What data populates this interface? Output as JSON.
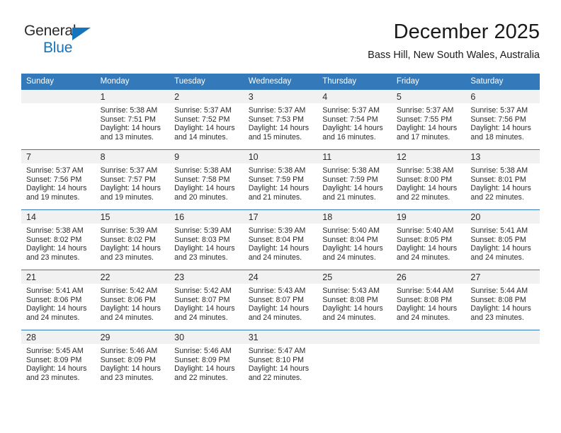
{
  "brand": {
    "name_top": "General",
    "name_bottom": "Blue",
    "triangle_icon": "triangle-icon",
    "colors": {
      "blue": "#1574bb",
      "dark": "#2b2b2b"
    }
  },
  "header": {
    "title": "December 2025",
    "subtitle": "Bass Hill, New South Wales, Australia"
  },
  "calendar": {
    "header_bg": "#3479b9",
    "daynum_bg": "#f1f1f1",
    "weekday_headers": [
      "Sunday",
      "Monday",
      "Tuesday",
      "Wednesday",
      "Thursday",
      "Friday",
      "Saturday"
    ],
    "weeks": [
      [
        {
          "day": "",
          "sunrise": "",
          "sunset": "",
          "daylight_line1": "",
          "daylight_line2": ""
        },
        {
          "day": "1",
          "sunrise": "Sunrise: 5:38 AM",
          "sunset": "Sunset: 7:51 PM",
          "daylight_line1": "Daylight: 14 hours",
          "daylight_line2": "and 13 minutes."
        },
        {
          "day": "2",
          "sunrise": "Sunrise: 5:37 AM",
          "sunset": "Sunset: 7:52 PM",
          "daylight_line1": "Daylight: 14 hours",
          "daylight_line2": "and 14 minutes."
        },
        {
          "day": "3",
          "sunrise": "Sunrise: 5:37 AM",
          "sunset": "Sunset: 7:53 PM",
          "daylight_line1": "Daylight: 14 hours",
          "daylight_line2": "and 15 minutes."
        },
        {
          "day": "4",
          "sunrise": "Sunrise: 5:37 AM",
          "sunset": "Sunset: 7:54 PM",
          "daylight_line1": "Daylight: 14 hours",
          "daylight_line2": "and 16 minutes."
        },
        {
          "day": "5",
          "sunrise": "Sunrise: 5:37 AM",
          "sunset": "Sunset: 7:55 PM",
          "daylight_line1": "Daylight: 14 hours",
          "daylight_line2": "and 17 minutes."
        },
        {
          "day": "6",
          "sunrise": "Sunrise: 5:37 AM",
          "sunset": "Sunset: 7:56 PM",
          "daylight_line1": "Daylight: 14 hours",
          "daylight_line2": "and 18 minutes."
        }
      ],
      [
        {
          "day": "7",
          "sunrise": "Sunrise: 5:37 AM",
          "sunset": "Sunset: 7:56 PM",
          "daylight_line1": "Daylight: 14 hours",
          "daylight_line2": "and 19 minutes."
        },
        {
          "day": "8",
          "sunrise": "Sunrise: 5:37 AM",
          "sunset": "Sunset: 7:57 PM",
          "daylight_line1": "Daylight: 14 hours",
          "daylight_line2": "and 19 minutes."
        },
        {
          "day": "9",
          "sunrise": "Sunrise: 5:38 AM",
          "sunset": "Sunset: 7:58 PM",
          "daylight_line1": "Daylight: 14 hours",
          "daylight_line2": "and 20 minutes."
        },
        {
          "day": "10",
          "sunrise": "Sunrise: 5:38 AM",
          "sunset": "Sunset: 7:59 PM",
          "daylight_line1": "Daylight: 14 hours",
          "daylight_line2": "and 21 minutes."
        },
        {
          "day": "11",
          "sunrise": "Sunrise: 5:38 AM",
          "sunset": "Sunset: 7:59 PM",
          "daylight_line1": "Daylight: 14 hours",
          "daylight_line2": "and 21 minutes."
        },
        {
          "day": "12",
          "sunrise": "Sunrise: 5:38 AM",
          "sunset": "Sunset: 8:00 PM",
          "daylight_line1": "Daylight: 14 hours",
          "daylight_line2": "and 22 minutes."
        },
        {
          "day": "13",
          "sunrise": "Sunrise: 5:38 AM",
          "sunset": "Sunset: 8:01 PM",
          "daylight_line1": "Daylight: 14 hours",
          "daylight_line2": "and 22 minutes."
        }
      ],
      [
        {
          "day": "14",
          "sunrise": "Sunrise: 5:38 AM",
          "sunset": "Sunset: 8:02 PM",
          "daylight_line1": "Daylight: 14 hours",
          "daylight_line2": "and 23 minutes."
        },
        {
          "day": "15",
          "sunrise": "Sunrise: 5:39 AM",
          "sunset": "Sunset: 8:02 PM",
          "daylight_line1": "Daylight: 14 hours",
          "daylight_line2": "and 23 minutes."
        },
        {
          "day": "16",
          "sunrise": "Sunrise: 5:39 AM",
          "sunset": "Sunset: 8:03 PM",
          "daylight_line1": "Daylight: 14 hours",
          "daylight_line2": "and 23 minutes."
        },
        {
          "day": "17",
          "sunrise": "Sunrise: 5:39 AM",
          "sunset": "Sunset: 8:04 PM",
          "daylight_line1": "Daylight: 14 hours",
          "daylight_line2": "and 24 minutes."
        },
        {
          "day": "18",
          "sunrise": "Sunrise: 5:40 AM",
          "sunset": "Sunset: 8:04 PM",
          "daylight_line1": "Daylight: 14 hours",
          "daylight_line2": "and 24 minutes."
        },
        {
          "day": "19",
          "sunrise": "Sunrise: 5:40 AM",
          "sunset": "Sunset: 8:05 PM",
          "daylight_line1": "Daylight: 14 hours",
          "daylight_line2": "and 24 minutes."
        },
        {
          "day": "20",
          "sunrise": "Sunrise: 5:41 AM",
          "sunset": "Sunset: 8:05 PM",
          "daylight_line1": "Daylight: 14 hours",
          "daylight_line2": "and 24 minutes."
        }
      ],
      [
        {
          "day": "21",
          "sunrise": "Sunrise: 5:41 AM",
          "sunset": "Sunset: 8:06 PM",
          "daylight_line1": "Daylight: 14 hours",
          "daylight_line2": "and 24 minutes."
        },
        {
          "day": "22",
          "sunrise": "Sunrise: 5:42 AM",
          "sunset": "Sunset: 8:06 PM",
          "daylight_line1": "Daylight: 14 hours",
          "daylight_line2": "and 24 minutes."
        },
        {
          "day": "23",
          "sunrise": "Sunrise: 5:42 AM",
          "sunset": "Sunset: 8:07 PM",
          "daylight_line1": "Daylight: 14 hours",
          "daylight_line2": "and 24 minutes."
        },
        {
          "day": "24",
          "sunrise": "Sunrise: 5:43 AM",
          "sunset": "Sunset: 8:07 PM",
          "daylight_line1": "Daylight: 14 hours",
          "daylight_line2": "and 24 minutes."
        },
        {
          "day": "25",
          "sunrise": "Sunrise: 5:43 AM",
          "sunset": "Sunset: 8:08 PM",
          "daylight_line1": "Daylight: 14 hours",
          "daylight_line2": "and 24 minutes."
        },
        {
          "day": "26",
          "sunrise": "Sunrise: 5:44 AM",
          "sunset": "Sunset: 8:08 PM",
          "daylight_line1": "Daylight: 14 hours",
          "daylight_line2": "and 24 minutes."
        },
        {
          "day": "27",
          "sunrise": "Sunrise: 5:44 AM",
          "sunset": "Sunset: 8:08 PM",
          "daylight_line1": "Daylight: 14 hours",
          "daylight_line2": "and 23 minutes."
        }
      ],
      [
        {
          "day": "28",
          "sunrise": "Sunrise: 5:45 AM",
          "sunset": "Sunset: 8:09 PM",
          "daylight_line1": "Daylight: 14 hours",
          "daylight_line2": "and 23 minutes."
        },
        {
          "day": "29",
          "sunrise": "Sunrise: 5:46 AM",
          "sunset": "Sunset: 8:09 PM",
          "daylight_line1": "Daylight: 14 hours",
          "daylight_line2": "and 23 minutes."
        },
        {
          "day": "30",
          "sunrise": "Sunrise: 5:46 AM",
          "sunset": "Sunset: 8:09 PM",
          "daylight_line1": "Daylight: 14 hours",
          "daylight_line2": "and 22 minutes."
        },
        {
          "day": "31",
          "sunrise": "Sunrise: 5:47 AM",
          "sunset": "Sunset: 8:10 PM",
          "daylight_line1": "Daylight: 14 hours",
          "daylight_line2": "and 22 minutes."
        },
        {
          "day": "",
          "sunrise": "",
          "sunset": "",
          "daylight_line1": "",
          "daylight_line2": ""
        },
        {
          "day": "",
          "sunrise": "",
          "sunset": "",
          "daylight_line1": "",
          "daylight_line2": ""
        },
        {
          "day": "",
          "sunrise": "",
          "sunset": "",
          "daylight_line1": "",
          "daylight_line2": ""
        }
      ]
    ]
  }
}
